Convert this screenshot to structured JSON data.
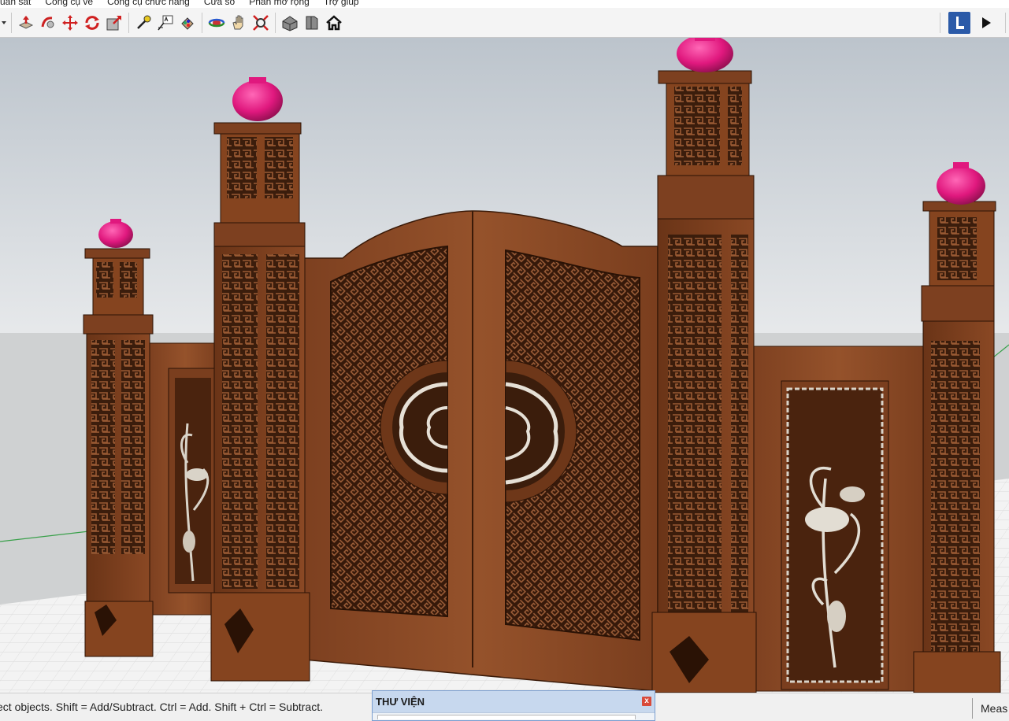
{
  "menu": {
    "items": [
      "uan sát",
      "Công cụ vẽ",
      "Công cụ chức năng",
      "Cửa sổ",
      "Phần mở rộng",
      "Trợ giúp"
    ]
  },
  "toolbar": {
    "icons": [
      "dropdown-arrow-icon",
      "push-pull-icon",
      "follow-me-icon",
      "move-icon",
      "rotate-icon",
      "scale-icon",
      "tape-measure-icon",
      "text-icon",
      "paint-bucket-icon",
      "orbit-icon",
      "pan-icon",
      "zoom-extents-icon",
      "warehouse-icon",
      "extension-icon",
      "home-icon"
    ],
    "right_icons": [
      "profile-icon",
      "play-icon"
    ]
  },
  "viewport": {
    "scene": "3D model of a carved wooden gate with four pillars",
    "colors": {
      "sky_top": "#bcc4cc",
      "sky_bottom": "#e7e9eb",
      "ground": "#f2f2f2",
      "wood": "#8a4b26",
      "wood_dark": "#5a2c12",
      "finial": "#e0187e"
    }
  },
  "status": {
    "text": "ect objects. Shift = Add/Subtract. Ctrl = Add. Shift + Ctrl = Subtract.",
    "measure_label": "Meas"
  },
  "library": {
    "title": "THƯ VIỆN",
    "close": "x"
  }
}
